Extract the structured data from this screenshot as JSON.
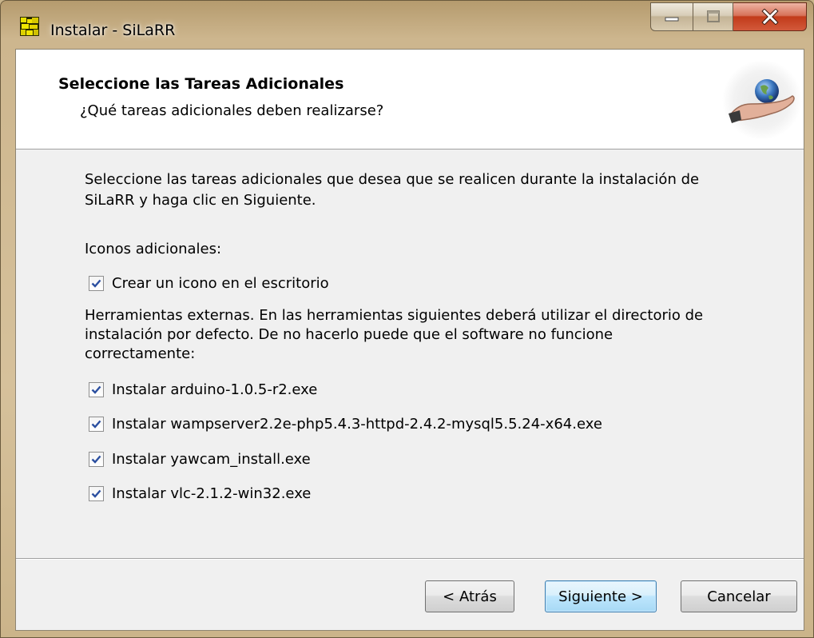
{
  "window": {
    "title": "Instalar - SiLaRR",
    "icon": "installer-app-icon",
    "controls": {
      "minimize": "minimize-icon",
      "maximize": "maximize-icon",
      "close": "close-icon"
    }
  },
  "header": {
    "title": "Seleccione las Tareas Adicionales",
    "subtitle": "¿Qué tareas adicionales deben realizarse?",
    "logo": "globe-hand-logo"
  },
  "content": {
    "intro_line1": "Seleccione las tareas adicionales que desea que se realicen durante la instalación de",
    "intro_line2": "SiLaRR y haga clic en Siguiente.",
    "group1_label": "Iconos adicionales:",
    "desktop_icon_task": {
      "label": "Crear un icono en el escritorio",
      "checked": true
    },
    "group2_line1": "Herramientas externas. En las herramientas siguientes deberá utilizar el directorio de",
    "group2_line2": "instalación por defecto. De no hacerlo puede que el software no funcione",
    "group2_line3": "correctamente:",
    "tools": [
      {
        "label": "Instalar arduino-1.0.5-r2.exe",
        "checked": true
      },
      {
        "label": "Instalar wampserver2.2e-php5.4.3-httpd-2.4.2-mysql5.5.24-x64.exe",
        "checked": true
      },
      {
        "label": "Instalar yawcam_install.exe",
        "checked": true
      },
      {
        "label": "Instalar vlc-2.1.2-win32.exe",
        "checked": true
      }
    ]
  },
  "buttons": {
    "back": "< Atrás",
    "next": "Siguiente >",
    "cancel": "Cancelar"
  },
  "colors": {
    "accent_button_border": "#3c7fb1",
    "close_button": "#c23b1a",
    "client_bg": "#f0f0f0"
  }
}
